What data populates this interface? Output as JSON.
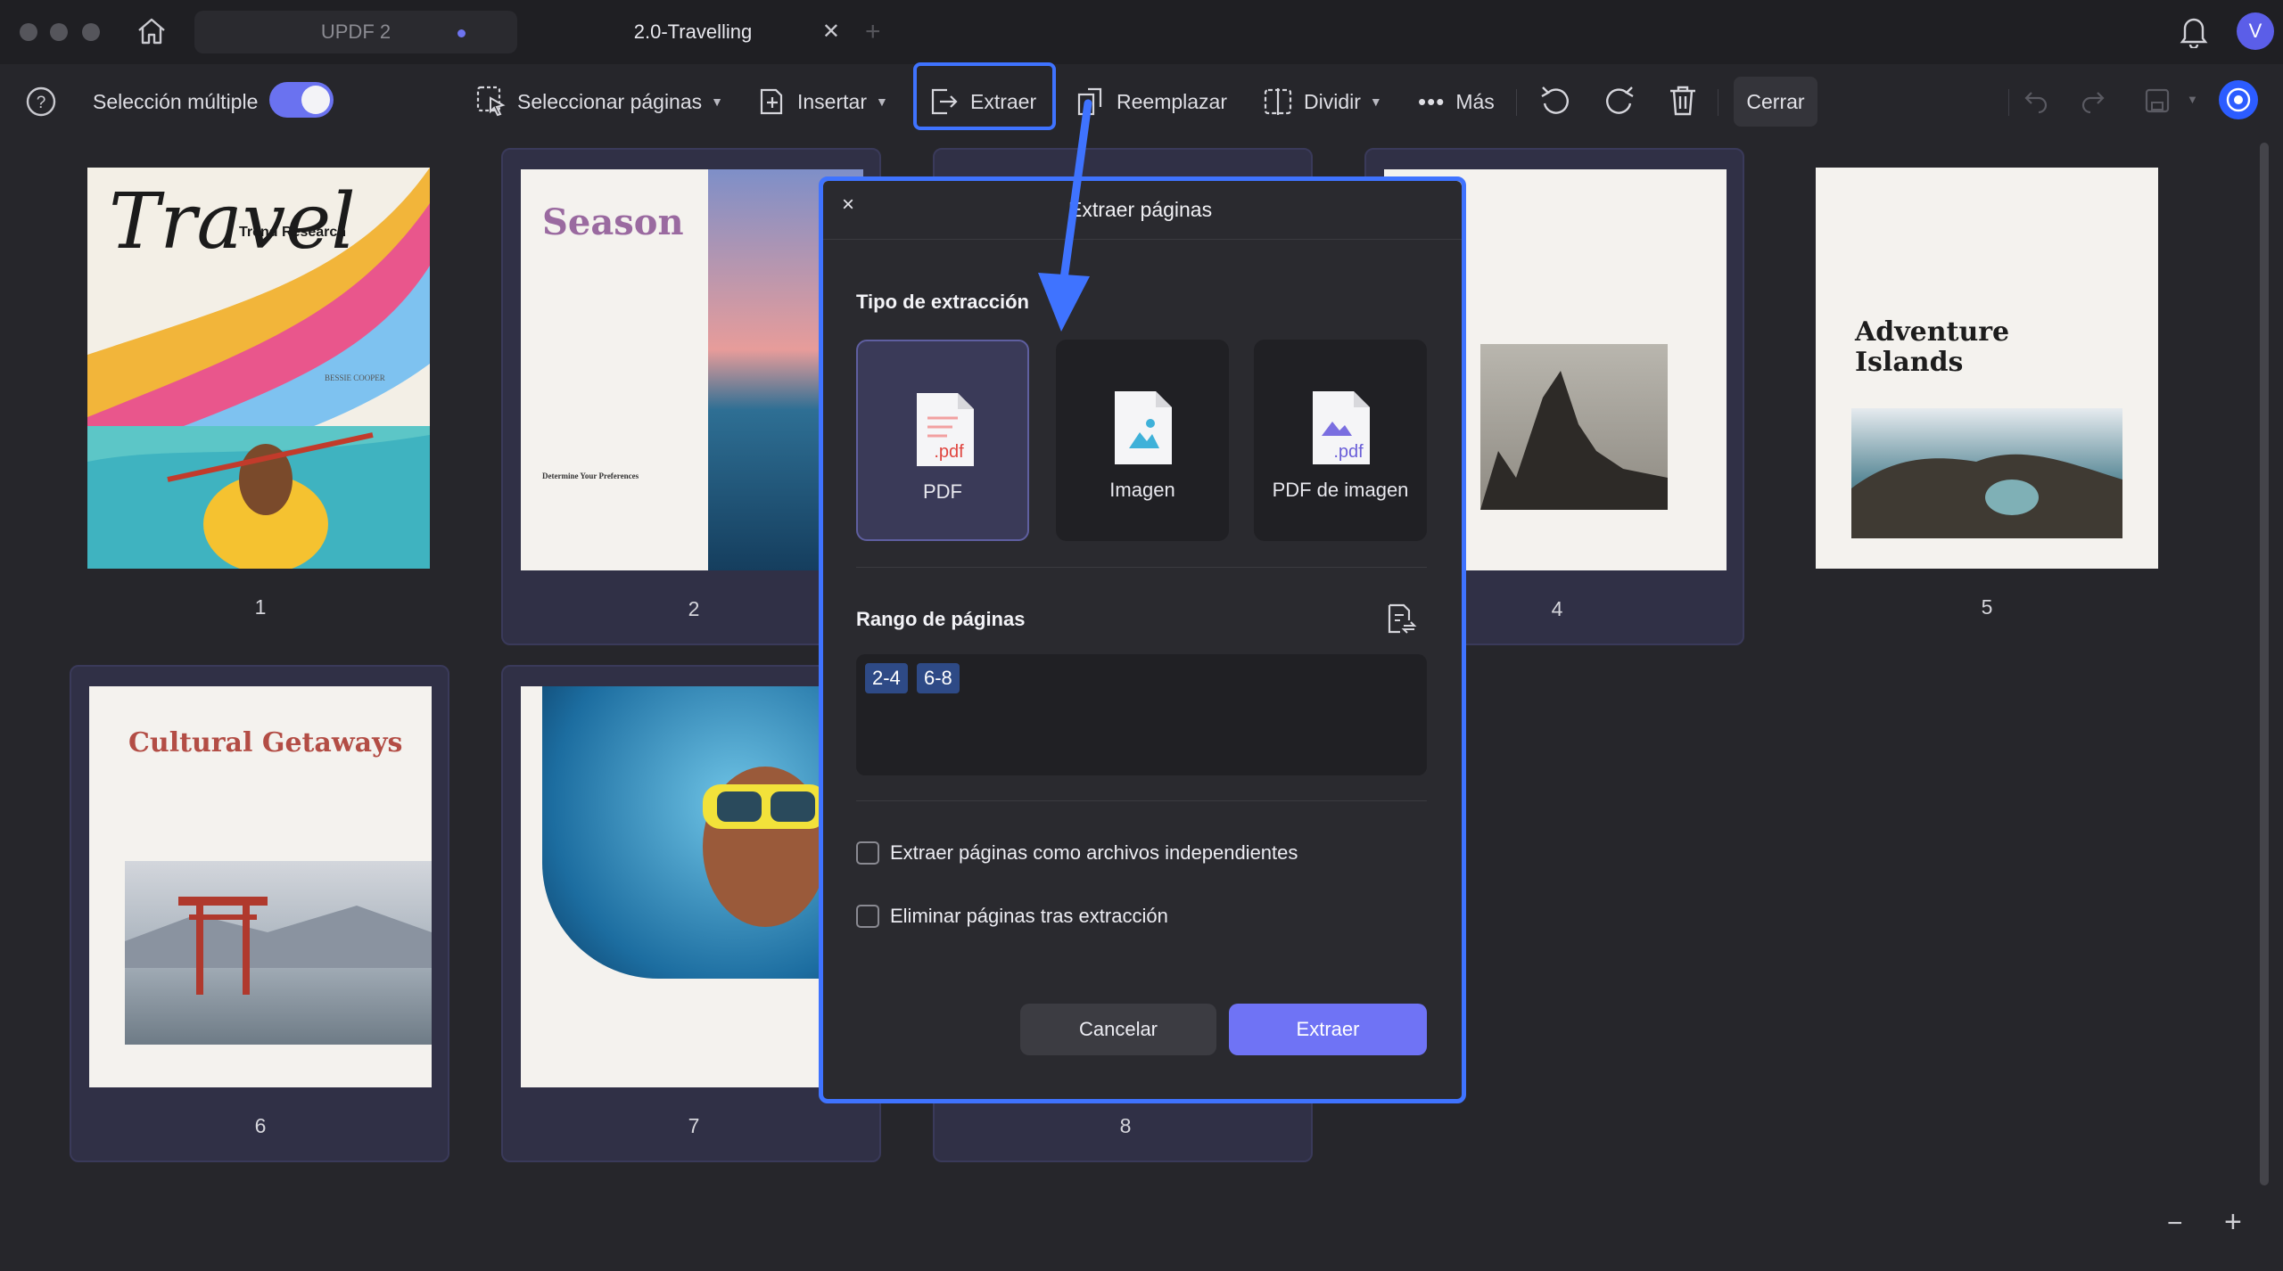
{
  "titlebar": {
    "tabs": [
      {
        "label": "UPDF 2"
      },
      {
        "label": "2.0-Travelling",
        "close": "✕"
      }
    ],
    "add_tab": "+",
    "avatar": "V"
  },
  "toolbar": {
    "multi_select_label": "Selección múltiple",
    "multi_select_on": true,
    "select_pages": "Seleccionar páginas",
    "insert": "Insertar",
    "extract": "Extraer",
    "replace": "Reemplazar",
    "split": "Dividir",
    "more": "Más",
    "close": "Cerrar"
  },
  "pages": [
    {
      "n": "1",
      "title": "Travel",
      "subtitle": "Trend Research",
      "author": "BESSIE COOPER"
    },
    {
      "n": "2",
      "title": "Season",
      "heading": "Determine Your Preferences"
    },
    {
      "n": "4"
    },
    {
      "n": "5",
      "title": "Adventure Islands"
    },
    {
      "n": "6",
      "title": "Cultural Getaways"
    },
    {
      "n": "7"
    },
    {
      "n": "8"
    }
  ],
  "dialog": {
    "close": "×",
    "title": "Extraer páginas",
    "type_label": "Tipo de extracción",
    "options": [
      {
        "label": "PDF",
        "selected": true
      },
      {
        "label": "Imagen",
        "selected": false
      },
      {
        "label": "PDF de imagen",
        "selected": false
      }
    ],
    "range_label": "Rango de páginas",
    "ranges": [
      "2-4",
      "6-8"
    ],
    "check_independent": "Extraer páginas como archivos independientes",
    "check_delete": "Eliminar páginas tras extracción",
    "cancel": "Cancelar",
    "extract": "Extraer"
  },
  "zoom": {
    "minus": "−",
    "plus": "+"
  },
  "colors": {
    "accent": "#6f73f5",
    "highlight": "#3f73ff",
    "background": "#26262b"
  }
}
